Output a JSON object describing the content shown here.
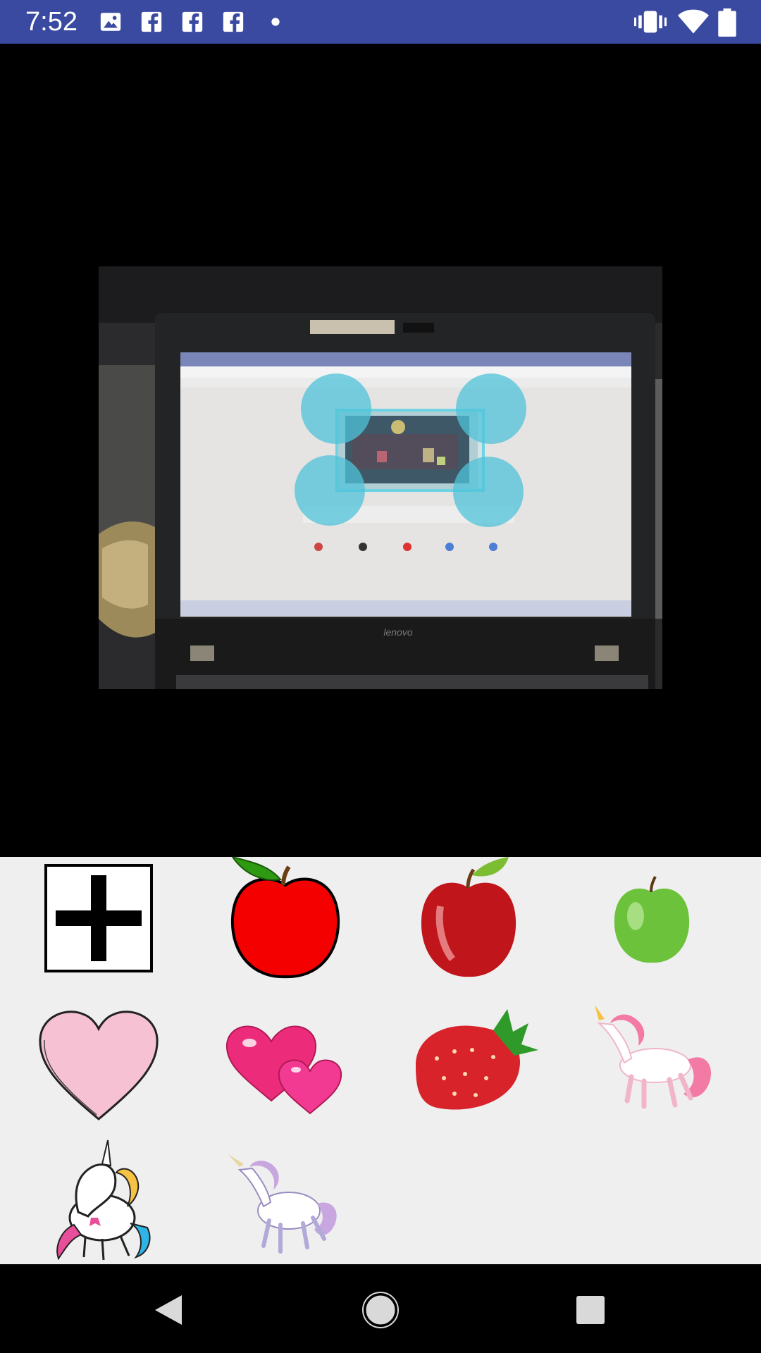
{
  "status_bar": {
    "time": "7:52",
    "left_icons": [
      "image-icon",
      "facebook-icon",
      "facebook-icon",
      "facebook-icon",
      "dot-icon"
    ],
    "right_icons": [
      "vibrate-icon",
      "wifi-icon",
      "battery-icon"
    ],
    "background": "#3a4aa1"
  },
  "preview": {
    "description_icons": [
      "laptop-photo",
      "crop-handle",
      "crop-handle",
      "crop-handle",
      "crop-handle"
    ],
    "handle_color": "#4fc3d8",
    "photo_text": {
      "brand": "lenovo"
    }
  },
  "stickers": {
    "items": [
      {
        "name": "add-sticker",
        "icon": "plus-icon"
      },
      {
        "name": "red-apple-cartoon",
        "icon": "apple-icon"
      },
      {
        "name": "red-apple-glossy",
        "icon": "apple-icon"
      },
      {
        "name": "green-apple",
        "icon": "apple-icon"
      },
      {
        "name": "pink-heart",
        "icon": "heart-icon"
      },
      {
        "name": "two-hearts",
        "icon": "hearts-icon"
      },
      {
        "name": "strawberry",
        "icon": "strawberry-icon"
      },
      {
        "name": "pink-unicorn",
        "icon": "unicorn-icon"
      },
      {
        "name": "rainbow-unicorn",
        "icon": "unicorn-icon"
      },
      {
        "name": "purple-unicorn",
        "icon": "unicorn-icon"
      }
    ]
  },
  "nav_bar": {
    "buttons": [
      "back",
      "home",
      "recents"
    ]
  }
}
